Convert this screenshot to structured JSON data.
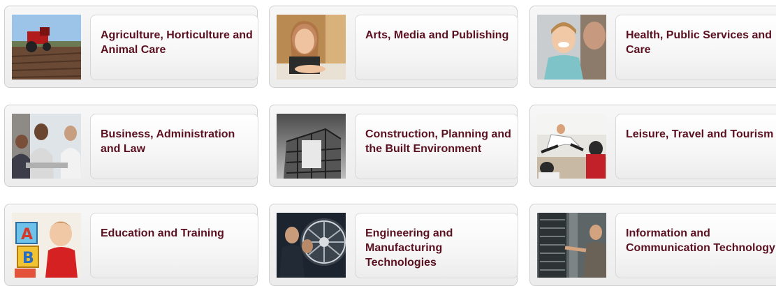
{
  "cards": [
    {
      "label": "Agriculture, Horticulture and Animal Care",
      "image": "tractor-field-photo"
    },
    {
      "label": "Arts, Media and Publishing",
      "image": "smiling-student-photo"
    },
    {
      "label": "Health, Public Services and Care",
      "image": "laughing-girl-photo"
    },
    {
      "label": "Business, Administration and Law",
      "image": "office-meeting-photo"
    },
    {
      "label": "Construction, Planning and the Built Environment",
      "image": "building-scaffold-photo"
    },
    {
      "label": "Leisure, Travel and Tourism",
      "image": "dance-class-photo"
    },
    {
      "label": "Education and Training",
      "image": "child-abc-blocks-photo"
    },
    {
      "label": "Engineering and Manufacturing Technologies",
      "image": "jet-engine-photo"
    },
    {
      "label": "Information and Communication Technology",
      "image": "server-rack-photo"
    }
  ]
}
